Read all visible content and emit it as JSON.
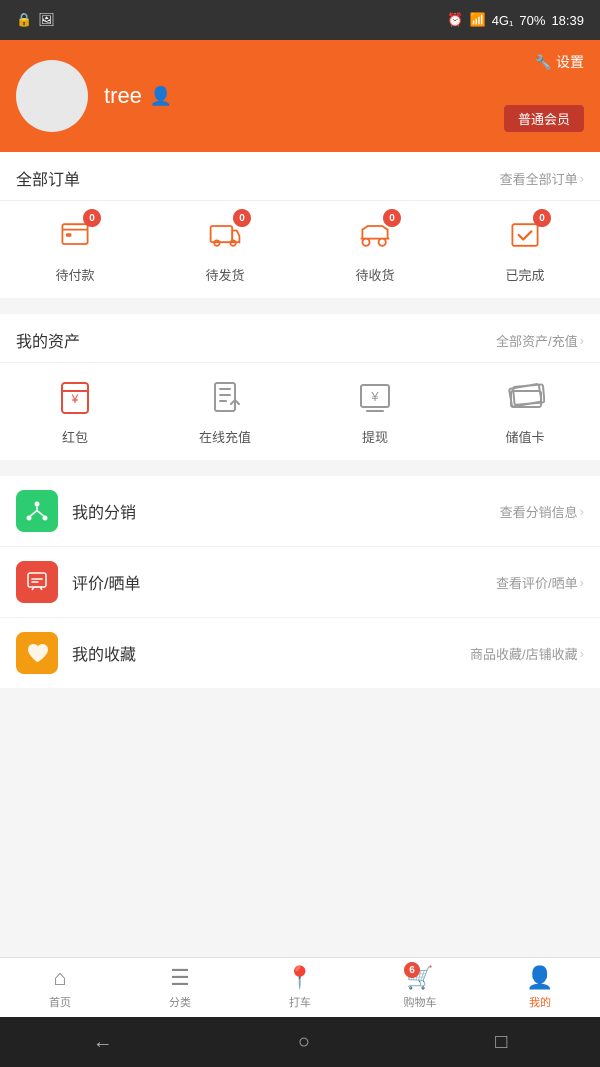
{
  "statusBar": {
    "left": [
      "🔒",
      "🖼"
    ],
    "time": "18:39",
    "network": "4G₁",
    "battery": "70%"
  },
  "header": {
    "settingsLabel": "设置",
    "username": "tree",
    "memberLabel": "普通会员"
  },
  "orders": {
    "sectionTitle": "全部订单",
    "viewAll": "查看全部订单",
    "items": [
      {
        "label": "待付款",
        "badge": "0"
      },
      {
        "label": "待发货",
        "badge": "0"
      },
      {
        "label": "待收货",
        "badge": "0"
      },
      {
        "label": "已完成",
        "badge": "0"
      }
    ]
  },
  "assets": {
    "sectionTitle": "我的资产",
    "viewAll": "全部资产/充值",
    "items": [
      {
        "label": "红包"
      },
      {
        "label": "在线充值"
      },
      {
        "label": "提现"
      },
      {
        "label": "储值卡"
      }
    ]
  },
  "listItems": [
    {
      "icon": "share",
      "bgClass": "green",
      "title": "我的分销",
      "rightLabel": "查看分销信息"
    },
    {
      "icon": "chat",
      "bgClass": "red",
      "title": "评价/晒单",
      "rightLabel": "查看评价/晒单"
    },
    {
      "icon": "heart",
      "bgClass": "orange",
      "title": "我的收藏",
      "rightLabel": "商品收藏/店铺收藏"
    }
  ],
  "bottomNav": {
    "items": [
      {
        "label": "首页",
        "active": false
      },
      {
        "label": "分类",
        "active": false
      },
      {
        "label": "打车",
        "active": false
      },
      {
        "label": "购物车",
        "active": false,
        "badge": "6"
      },
      {
        "label": "我的",
        "active": true
      }
    ]
  }
}
